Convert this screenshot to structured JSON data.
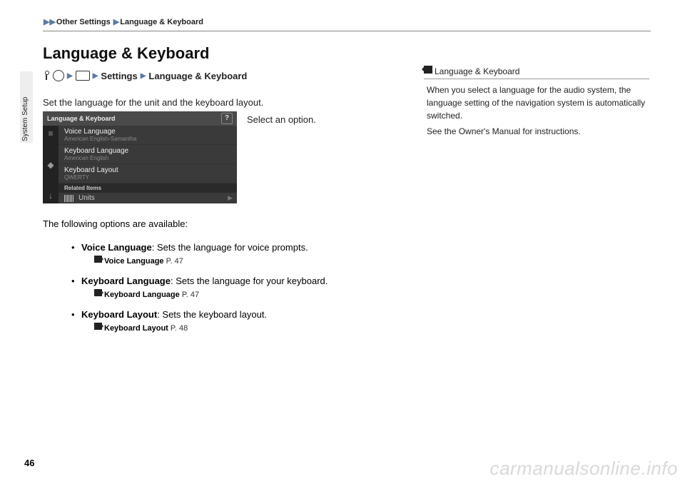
{
  "breadcrumb": {
    "item1": "Other Settings",
    "item2": "Language & Keyboard"
  },
  "sideTab": "System Setup",
  "title": "Language & Keyboard",
  "navLine": {
    "settings": "Settings",
    "section": "Language & Keyboard"
  },
  "intro": "Set the language for the unit and the keyboard layout.",
  "caption": "Select an option.",
  "mockup": {
    "header": "Language & Keyboard",
    "help": "?",
    "items": [
      {
        "t": "Voice Language",
        "s": "American English-Samantha"
      },
      {
        "t": "Keyboard Language",
        "s": "American English"
      },
      {
        "t": "Keyboard Layout",
        "s": "QWERTY"
      }
    ],
    "related": "Related Items",
    "units": "Units"
  },
  "optionsIntro": "The following options are available:",
  "options": [
    {
      "name": "Voice Language",
      "desc": ": Sets the language for voice prompts.",
      "ref": "Voice Language",
      "page": "P. 47"
    },
    {
      "name": "Keyboard Language",
      "desc": ": Sets the language for your keyboard.",
      "ref": "Keyboard Language",
      "page": "P. 47"
    },
    {
      "name": "Keyboard Layout",
      "desc": ": Sets the keyboard layout.",
      "ref": "Keyboard Layout",
      "page": "P. 48"
    }
  ],
  "note": {
    "head": "Language & Keyboard",
    "p1": "When you select a language for the audio system, the language setting of the navigation system is automatically switched.",
    "p2": "See the Owner's Manual for instructions."
  },
  "pageNum": "46",
  "watermark": "carmanualsonline.info"
}
